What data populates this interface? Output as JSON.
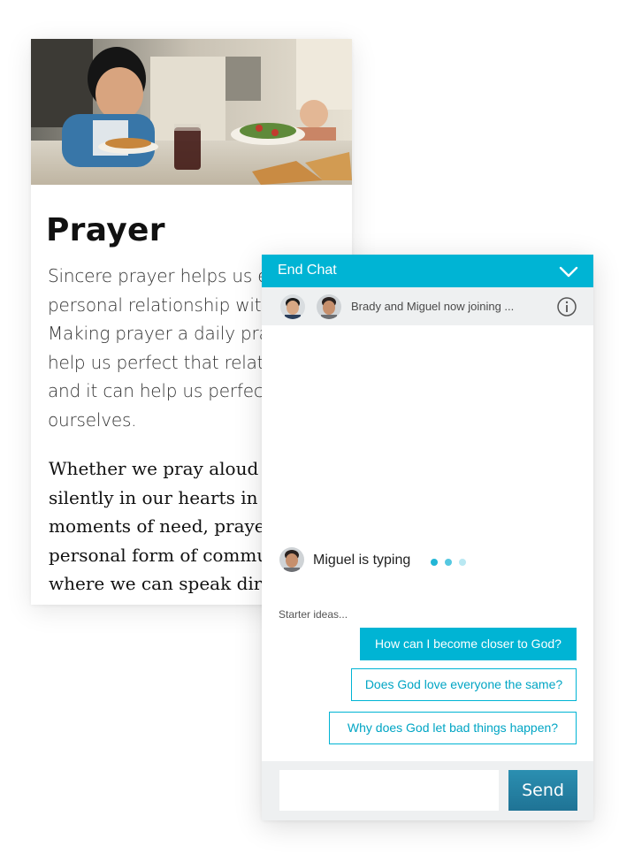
{
  "article": {
    "title": "Prayer",
    "body_lines": [
      "Sincere prayer helps us est",
      "personal relationship with",
      "Making prayer a daily pract",
      "help us perfect that relatio",
      "and it can help us perfect",
      "ourselves."
    ],
    "quote_lines": [
      "Whether we pray aloud or",
      "silently in our hearts in fle",
      "moments of need, prayer i",
      "personal form of commun",
      "where we can speak direct"
    ]
  },
  "chat": {
    "header": {
      "end_chat_label": "End Chat",
      "collapse_icon": "chevron-down-icon"
    },
    "participants": {
      "status_text": "Brady and Miguel now joining ...",
      "info_icon": "info-icon"
    },
    "typing": {
      "text": "Miguel is typing"
    },
    "starters": {
      "label": "Starter ideas...",
      "items": [
        "How can I become closer to God?",
        "Does God love everyone the same?",
        "Why does God let bad things happen?"
      ]
    },
    "composer": {
      "input_value": "",
      "send_label": "Send"
    },
    "colors": {
      "accent": "#00b4d4",
      "send_button": "#2383a6",
      "panel_gray": "#eef0f1"
    }
  }
}
